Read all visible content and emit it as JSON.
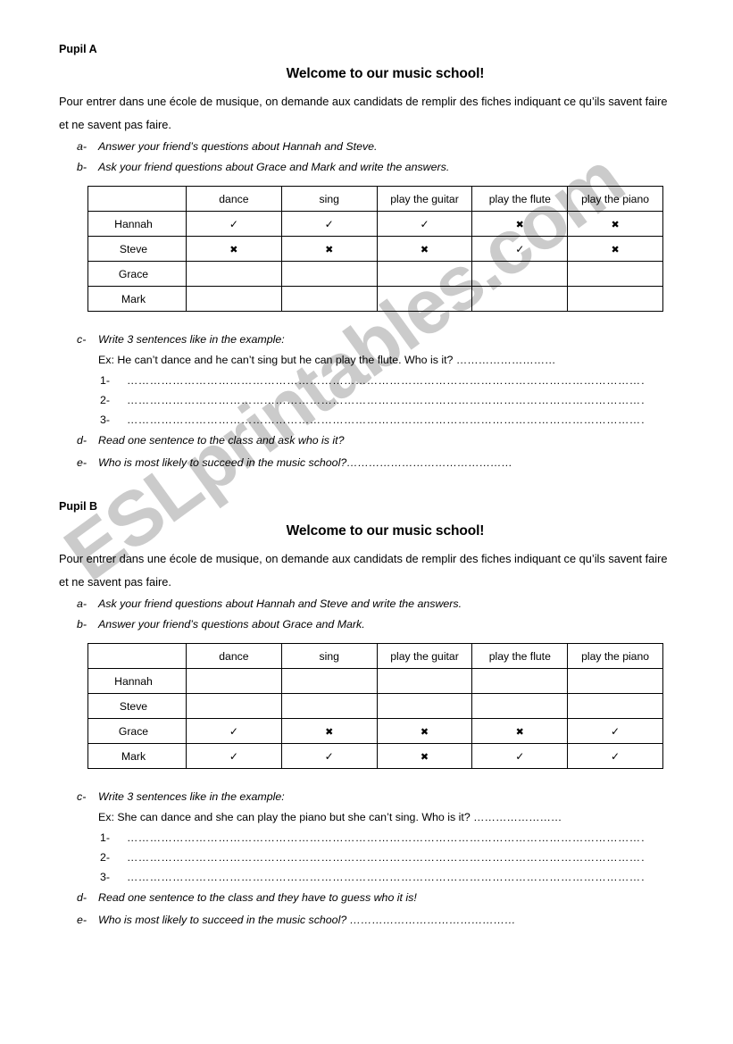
{
  "watermark": {
    "text": "ESLprintables.com",
    "color": "#c9c9c9"
  },
  "shared": {
    "title": "Welcome to our music school!",
    "intro": "Pour entrer dans une école de musique, on demande aux candidats de remplir des fiches indiquant ce qu’ils savent faire et ne savent pas faire.",
    "columns": [
      "",
      "dance",
      "sing",
      "play the guitar",
      "play the flute",
      "play the piano"
    ],
    "rows": [
      "Hannah",
      "Steve",
      "Grace",
      "Mark"
    ],
    "c_label": "c-",
    "c_text": "Write 3 sentences like in the example:",
    "d_label": "d-",
    "e_label": "e-",
    "a_label": "a-",
    "b_label": "b-",
    "numbers": [
      "1-",
      "2-",
      "3-"
    ],
    "dots_long": "……………………………………………………………………………………………………………………………………………………………………",
    "mark_check": "✓",
    "mark_cross": "✖"
  },
  "pupil_a": {
    "pupil_label": "Pupil A",
    "task_a": "Answer your friend’s questions about Hannah and Steve.",
    "task_b": "Ask your friend questions about Grace and Mark and write the answers.",
    "example": "Ex: He can’t dance and he can’t sing but he can play the flute. Who is it? ………………………",
    "task_d": "Read one sentence to the class and ask who is it?",
    "task_e": "Who is most likely to succeed in the music school?………………………………………",
    "table": [
      {
        "name": "Hannah",
        "marks": [
          "check",
          "check",
          "check",
          "cross",
          "cross"
        ]
      },
      {
        "name": "Steve",
        "marks": [
          "cross",
          "cross",
          "cross",
          "check",
          "cross"
        ]
      },
      {
        "name": "Grace",
        "marks": [
          "",
          "",
          "",
          "",
          ""
        ]
      },
      {
        "name": "Mark",
        "marks": [
          "",
          "",
          "",
          "",
          ""
        ]
      }
    ]
  },
  "pupil_b": {
    "pupil_label": "Pupil B",
    "task_a": "Ask your friend questions about Hannah and Steve and write the answers.",
    "task_b": "Answer your friend’s questions about Grace and Mark.",
    "example": "Ex: She can dance and she can play the piano but she can’t sing. Who is it? ……………………",
    "task_d": "Read one sentence to the class and they have to guess who it is!",
    "task_e": "Who is most likely to succeed in the music school? ………………………………………",
    "table": [
      {
        "name": "Hannah",
        "marks": [
          "",
          "",
          "",
          "",
          ""
        ]
      },
      {
        "name": "Steve",
        "marks": [
          "",
          "",
          "",
          "",
          ""
        ]
      },
      {
        "name": "Grace",
        "marks": [
          "check",
          "cross",
          "cross",
          "cross",
          "check"
        ]
      },
      {
        "name": "Mark",
        "marks": [
          "check",
          "check",
          "cross",
          "check",
          "check"
        ]
      }
    ]
  }
}
